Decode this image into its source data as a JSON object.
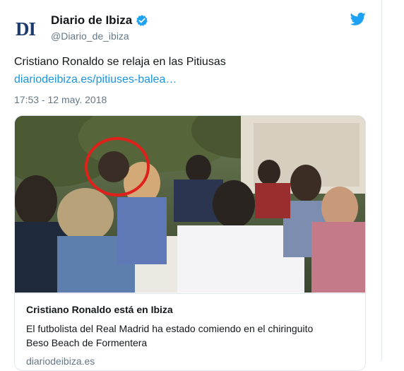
{
  "tweet": {
    "author": {
      "logo_text": "DI",
      "display_name": "Diario de Ibiza",
      "handle": "@Diario_de_ibiza",
      "verified": true
    },
    "text": "Cristiano Ronaldo se relaja en las Pitiusas",
    "link_text": "diariodeibiza.es/pitiuses-balea…",
    "timestamp": "17:53 - 12 may. 2018",
    "card": {
      "title": "Cristiano Ronaldo está en Ibiza",
      "description": "El futbolista del Real Madrid ha estado comiendo en el chiringuito Beso Beach de Formentera",
      "domain": "diariodeibiza.es"
    }
  },
  "icons": {
    "verified": "verified-badge-icon",
    "brand": "twitter-bird-icon"
  },
  "colors": {
    "link": "#1b95e0",
    "verified": "#1da1f2",
    "logo": "#1b3b6f",
    "highlight_circle": "#e0201b"
  }
}
